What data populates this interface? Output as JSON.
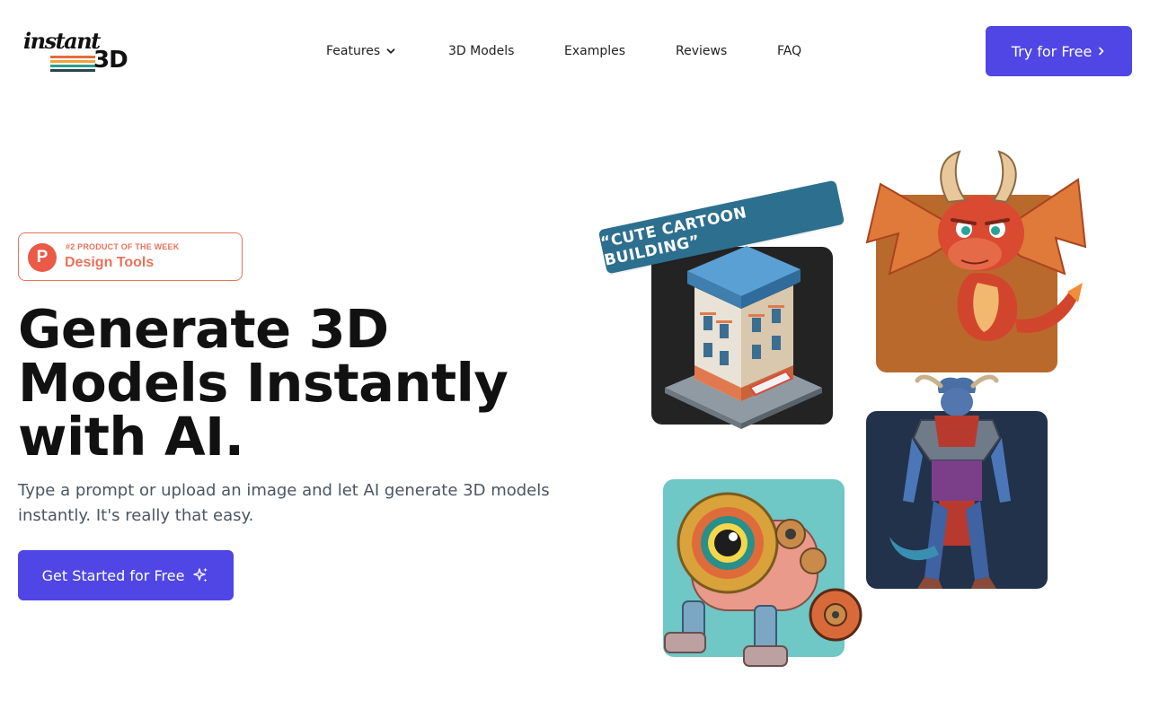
{
  "header": {
    "logo": {
      "line1": "instant",
      "line2": "3D"
    },
    "nav": [
      {
        "label": "Features",
        "has_dropdown": true
      },
      {
        "label": "3D Models"
      },
      {
        "label": "Examples"
      },
      {
        "label": "Reviews"
      },
      {
        "label": "FAQ"
      }
    ],
    "cta": {
      "label": "Try for Free",
      "icon": "chevron-right-icon"
    }
  },
  "badge": {
    "logo_letter": "P",
    "kicker": "#2 PRODUCT OF THE WEEK",
    "title": "Design Tools"
  },
  "hero": {
    "title": "Generate 3D Models Instantly with AI.",
    "subtitle": "Type a prompt or upload an image and let AI generate 3D models instantly. It's really that easy.",
    "cta": {
      "label": "Get Started for Free",
      "icon": "sparkles-icon"
    }
  },
  "collage": {
    "prompt_tag": "“CUTE CARTOON BUILDING”",
    "cards": [
      {
        "name": "building",
        "icon": "isometric-building-image"
      },
      {
        "name": "dragon",
        "icon": "cartoon-dragon-image"
      },
      {
        "name": "warrior",
        "icon": "armored-warrior-image"
      },
      {
        "name": "robot",
        "icon": "robot-creature-image"
      }
    ]
  },
  "colors": {
    "accent": "#4f46e5",
    "badge": "#e8735a",
    "text": "#111111",
    "muted": "#4b5563",
    "tag": "#2d6f8e"
  }
}
